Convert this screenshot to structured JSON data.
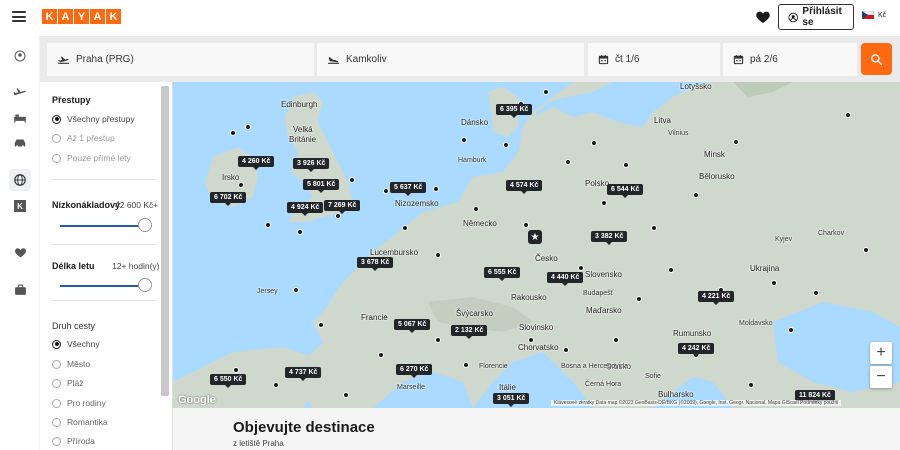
{
  "header": {
    "logo_letters": [
      "K",
      "A",
      "Y",
      "A",
      "K"
    ],
    "login_label": "Přihlásit se",
    "currency": "Kč",
    "accent_color": "#ff690f"
  },
  "rail": {
    "icons": [
      "user-icon",
      "plane-icon",
      "bed-icon",
      "car-icon",
      "globe-icon",
      "kayak-k-icon",
      "heart-icon",
      "briefcase-icon"
    ]
  },
  "search": {
    "origin": "Praha (PRG)",
    "destination": "Kamkoliv",
    "depart": "čt 1/6",
    "return": "pá 2/6"
  },
  "filters": {
    "stops_title": "Přestupy",
    "stops_options": [
      {
        "label": "Všechny přestupy",
        "selected": true,
        "disabled": false
      },
      {
        "label": "Až 1 přestup",
        "selected": false,
        "disabled": true
      },
      {
        "label": "Pouze přímé lety",
        "selected": false,
        "disabled": true
      }
    ],
    "price_title": "Nízkonákladový",
    "price_value": "42 600 Kč+",
    "duration_title": "Délka letu",
    "duration_value": "12+ hodin(y)",
    "trip_title": "Druh cesty",
    "trip_options": [
      {
        "label": "Všechny",
        "selected": true
      },
      {
        "label": "Město",
        "selected": false
      },
      {
        "label": "Pláž",
        "selected": false
      },
      {
        "label": "Pro rodiny",
        "selected": false
      },
      {
        "label": "Romantika",
        "selected": false
      },
      {
        "label": "Příroda",
        "selected": false
      }
    ]
  },
  "map": {
    "places": [
      "Edinburgh",
      "Velká",
      "Británie",
      "Irsko",
      "Dánsko",
      "Hamburk",
      "Nizozemsko",
      "Německo",
      "Lucembursko",
      "Česko",
      "Polsko",
      "Bělorusko",
      "Litva",
      "Lotyšsko",
      "Vilnius",
      "Minsk",
      "Kyjev",
      "Charkov",
      "Ukrajina",
      "Slovensko",
      "Budapešť",
      "Maďarsko",
      "Rakousko",
      "Švýcarsko",
      "Francie",
      "Slovinsko",
      "Chorvatsko",
      "Rumunsko",
      "Srbsko",
      "Bulharsko",
      "Sofie",
      "Itálie",
      "Florencie",
      "Marseille",
      "Moldavsko",
      "Bosna a Hercegovina",
      "Černá Hora",
      "Jersey"
    ],
    "prices": [
      "6 395 Kč",
      "4 260 Kč",
      "3 926 Kč",
      "5 801 Kč",
      "6 702 Kč",
      "4 924 Kč",
      "7 269 Kč",
      "5 637 Kč",
      "4 574 Kč",
      "6 544 Kč",
      "3 382 Kč",
      "3 678 Kč",
      "6 555 Kč",
      "4 440 Kč",
      "4 221 Kč",
      "5 067 Kč",
      "2 132 Kč",
      "4 242 Kč",
      "6 550 Kč",
      "4 737 Kč",
      "6 270 Kč",
      "3 051 Kč",
      "11 824 Kč"
    ],
    "zoom_in": "+",
    "zoom_out": "−",
    "google": "Google",
    "footer": "Klávesové zkratky    Data map ©2023 GeoBasis-DE/BKG (©2009), Google, Inst. Geogr. Nacional, Mapa GISrael    Podmínky použití"
  },
  "content": {
    "title": "Objevujte destinace",
    "subtitle": "z letiště Praha"
  }
}
